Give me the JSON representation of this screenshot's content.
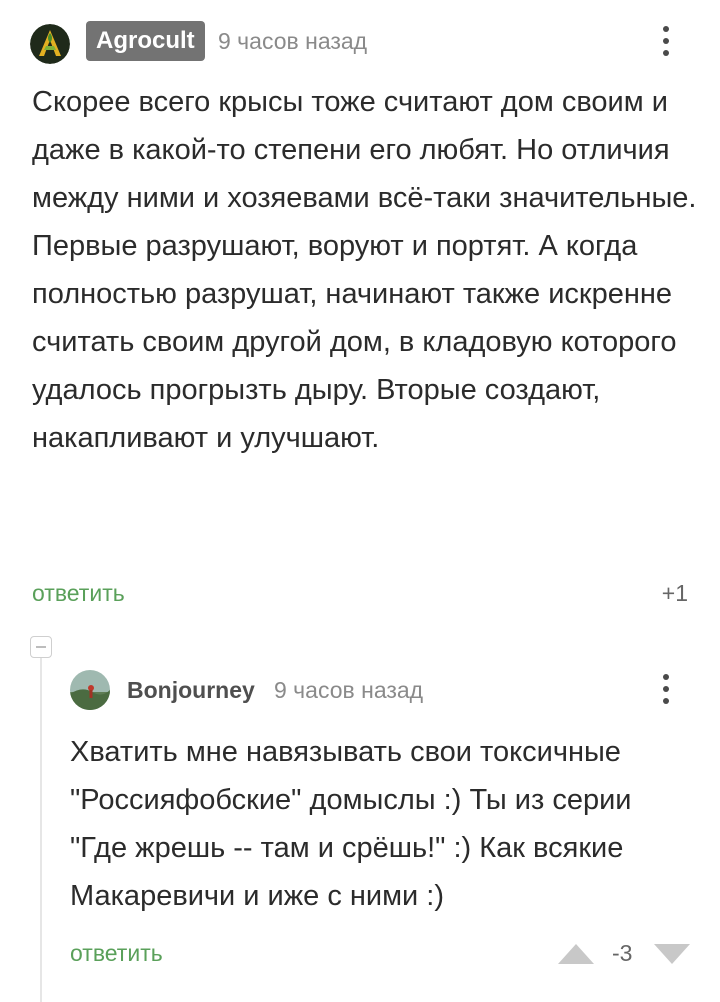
{
  "comments": [
    {
      "author": "Agrocult",
      "time": "9 часов назад",
      "text": "Скорее всего крысы тоже считают дом своим и даже в какой-то степени его любят. Но отличия между ними и хозяевами всё-таки значительные. Первые разрушают, воруют и портят. А когда полностью разрушат, начинают также искренне считать своим другой дом, в кладовую которого удалось прогрызть дыру. Вторые создают, накапливают и улучшают.",
      "reply_label": "ответить",
      "rating": "+1"
    },
    {
      "author": "Bonjourney",
      "time": "9 часов назад",
      "text": "Хватить мне навязывать свои токсичные \"Россияфобские\" домыслы :) Ты из серии \"Где жрешь -- там и срёшь!\" :) Как всякие Макаревичи и иже с ними :)",
      "reply_label": "ответить",
      "rating": "-3"
    }
  ],
  "icons": {
    "avatar_1": "agrocult-logo-avatar",
    "avatar_2": "landscape-photo-avatar",
    "menu": "kebab-menu-icon",
    "collapse": "collapse-thread-icon",
    "upvote": "upvote-arrow-icon",
    "downvote": "downvote-arrow-icon"
  },
  "colors": {
    "text": "#2b2b2b",
    "muted": "#8a8a8a",
    "link_green": "#5aa05a",
    "badge_bg": "#737373",
    "vote_arrow": "#c8c8c8"
  }
}
